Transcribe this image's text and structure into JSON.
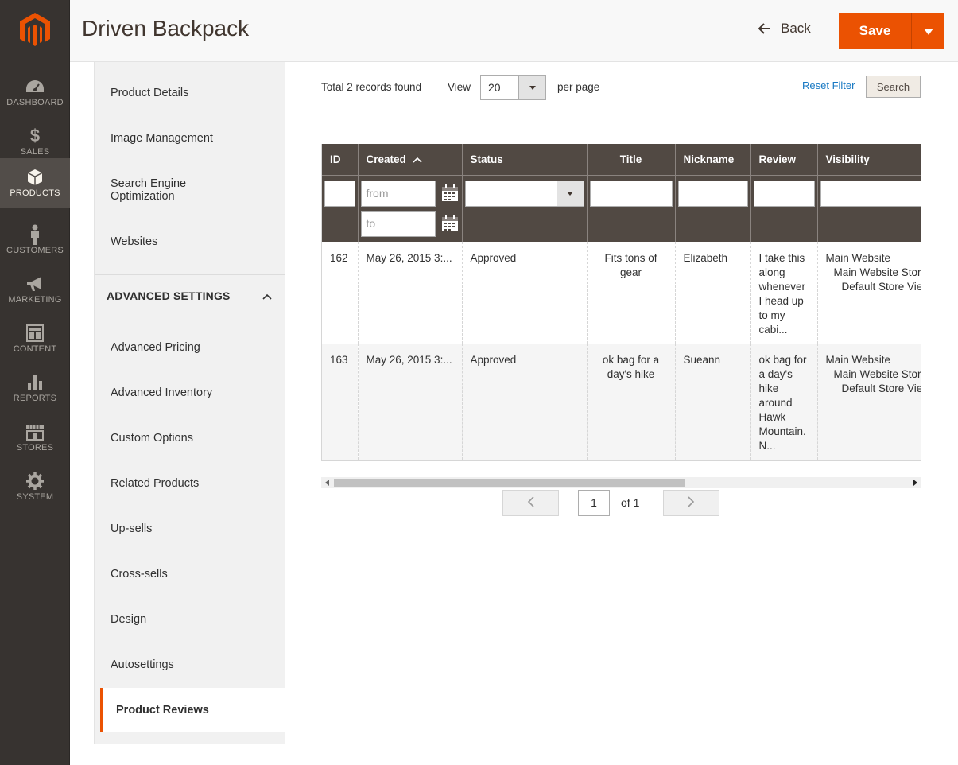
{
  "header": {
    "title": "Driven Backpack",
    "back_label": "Back",
    "save_label": "Save"
  },
  "admin_nav": [
    {
      "label": "DASHBOARD",
      "icon": "dashboard-icon"
    },
    {
      "label": "SALES",
      "icon": "dollar-icon"
    },
    {
      "label": "PRODUCTS",
      "icon": "box-icon",
      "active": true
    },
    {
      "label": "CUSTOMERS",
      "icon": "person-icon"
    },
    {
      "label": "MARKETING",
      "icon": "megaphone-icon"
    },
    {
      "label": "CONTENT",
      "icon": "layout-icon"
    },
    {
      "label": "REPORTS",
      "icon": "bar-chart-icon"
    },
    {
      "label": "STORES",
      "icon": "storefront-icon"
    },
    {
      "label": "SYSTEM",
      "icon": "gear-icon"
    }
  ],
  "sidebar": {
    "items_top": [
      "Product Details",
      "Image Management",
      "Search Engine Optimization",
      "Websites"
    ],
    "section_title": "ADVANCED SETTINGS",
    "items_advanced": [
      "Advanced Pricing",
      "Advanced Inventory",
      "Custom Options",
      "Related Products",
      "Up-sells",
      "Cross-sells",
      "Design",
      "Autosettings",
      "Product Reviews"
    ],
    "active": "Product Reviews"
  },
  "toolbar": {
    "records": "Total 2 records found",
    "view_label": "View",
    "per_page_value": "20",
    "per_page_label": "per page",
    "reset_filter": "Reset Filter",
    "search": "Search"
  },
  "grid": {
    "columns": [
      "ID",
      "Created",
      "Status",
      "Title",
      "Nickname",
      "Review",
      "Visibility"
    ],
    "filters": {
      "from_placeholder": "from",
      "to_placeholder": "to"
    },
    "rows": [
      {
        "id": "162",
        "created": "May 26, 2015 3:...",
        "status": "Approved",
        "title": "Fits tons of gear",
        "nickname": "Elizabeth",
        "review": "I take this along whenever I head up to my cabi...",
        "visibility": [
          "Main Website",
          "Main Website Store",
          "Default Store View"
        ]
      },
      {
        "id": "163",
        "created": "May 26, 2015 3:...",
        "status": "Approved",
        "title": "ok bag for a day's hike",
        "nickname": "Sueann",
        "review": "ok bag for a day's hike around Hawk Mountain. N...",
        "visibility": [
          "Main Website",
          "Main Website Store",
          "Default Store View"
        ]
      }
    ]
  },
  "pager": {
    "current": "1",
    "of_label": "of 1"
  },
  "colors": {
    "accent": "#eb5202",
    "nav_bg": "#373330",
    "grid_header": "#514943",
    "link": "#1979c3"
  }
}
